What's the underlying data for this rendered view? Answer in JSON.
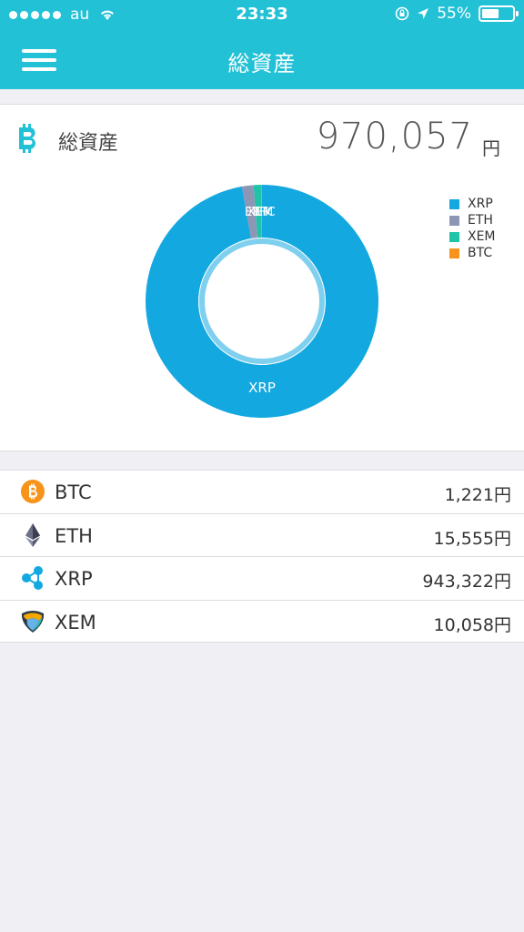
{
  "status_bar": {
    "carrier": "au",
    "time": "23:33",
    "battery": "55%",
    "battery_level": 0.55
  },
  "nav": {
    "title": "総資産",
    "menu_icon": "hamburger-menu-icon"
  },
  "summary": {
    "label": "総資産",
    "total": "970,057",
    "unit": "円",
    "icon": "bitcoin-logo-icon"
  },
  "chart_data": {
    "type": "pie",
    "categories": [
      "XRP",
      "ETH",
      "XEM",
      "BTC"
    ],
    "values": [
      943322,
      15555,
      10058,
      1221
    ],
    "colors": [
      "#13a8e0",
      "#8e96b5",
      "#1fc3a8",
      "#f7931a"
    ],
    "inner_label": "XRP",
    "legend_position": "top-right"
  },
  "assets": [
    {
      "name": "BTC",
      "value": "1,221円",
      "icon": "btc-coin-icon"
    },
    {
      "name": "ETH",
      "value": "15,555円",
      "icon": "eth-diamond-icon"
    },
    {
      "name": "XRP",
      "value": "943,322円",
      "icon": "xrp-ripple-icon"
    },
    {
      "name": "XEM",
      "value": "10,058円",
      "icon": "xem-nem-icon"
    }
  ],
  "colors": {
    "brand": "#22c1d6",
    "background": "#efeff4"
  }
}
